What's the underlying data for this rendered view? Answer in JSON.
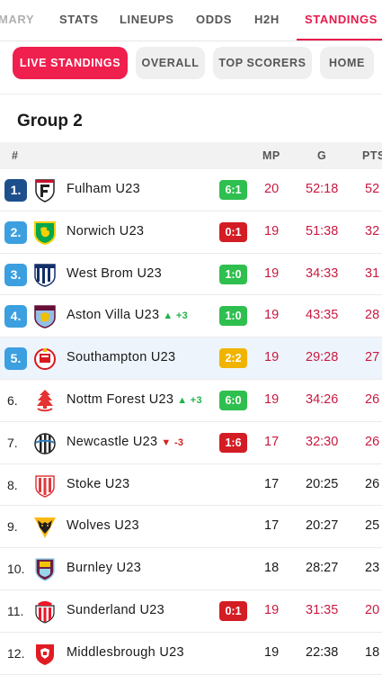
{
  "tabs": [
    {
      "label": "MARY"
    },
    {
      "label": "STATS"
    },
    {
      "label": "LINEUPS"
    },
    {
      "label": "ODDS"
    },
    {
      "label": "H2H"
    },
    {
      "label": "STANDINGS"
    }
  ],
  "chips": [
    {
      "label": "LIVE STANDINGS"
    },
    {
      "label": "OVERALL"
    },
    {
      "label": "TOP SCORERS"
    },
    {
      "label": "HOME"
    }
  ],
  "group": {
    "title": "Group 2"
  },
  "table": {
    "headers": {
      "rank": "#",
      "mp": "MP",
      "g": "G",
      "pts": "PTS"
    },
    "rows": [
      {
        "rank": "1.",
        "team": "Fulham U23",
        "move": "",
        "form": "6:1",
        "mp": "20",
        "g": "52:18",
        "pts": "52"
      },
      {
        "rank": "2.",
        "team": "Norwich U23",
        "move": "",
        "form": "0:1",
        "mp": "19",
        "g": "51:38",
        "pts": "32"
      },
      {
        "rank": "3.",
        "team": "West Brom U23",
        "move": "",
        "form": "1:0",
        "mp": "19",
        "g": "34:33",
        "pts": "31"
      },
      {
        "rank": "4.",
        "team": "Aston Villa U23",
        "move": "+3",
        "form": "1:0",
        "mp": "19",
        "g": "43:35",
        "pts": "28"
      },
      {
        "rank": "5.",
        "team": "Southampton U23",
        "move": "",
        "form": "2:2",
        "mp": "19",
        "g": "29:28",
        "pts": "27"
      },
      {
        "rank": "6.",
        "team": "Nottm Forest U23",
        "move": "+3",
        "form": "6:0",
        "mp": "19",
        "g": "34:26",
        "pts": "26"
      },
      {
        "rank": "7.",
        "team": "Newcastle U23",
        "move": "-3",
        "form": "1:6",
        "mp": "17",
        "g": "32:30",
        "pts": "26"
      },
      {
        "rank": "8.",
        "team": "Stoke U23",
        "move": "",
        "form": "",
        "mp": "17",
        "g": "20:25",
        "pts": "26"
      },
      {
        "rank": "9.",
        "team": "Wolves U23",
        "move": "",
        "form": "",
        "mp": "17",
        "g": "20:27",
        "pts": "25"
      },
      {
        "rank": "10.",
        "team": "Burnley U23",
        "move": "",
        "form": "",
        "mp": "18",
        "g": "28:27",
        "pts": "23"
      },
      {
        "rank": "11.",
        "team": "Sunderland U23",
        "move": "",
        "form": "0:1",
        "mp": "19",
        "g": "31:35",
        "pts": "20"
      },
      {
        "rank": "12.",
        "team": "Middlesbrough U23",
        "move": "",
        "form": "",
        "mp": "19",
        "g": "22:38",
        "pts": "18"
      }
    ]
  },
  "colors": {
    "accent": "#e6194b",
    "win": "#2fbf4f",
    "loss": "#d41c24",
    "draw": "#f0b400",
    "promo": "#3b9fe0",
    "champ": "#1d4f8c"
  }
}
